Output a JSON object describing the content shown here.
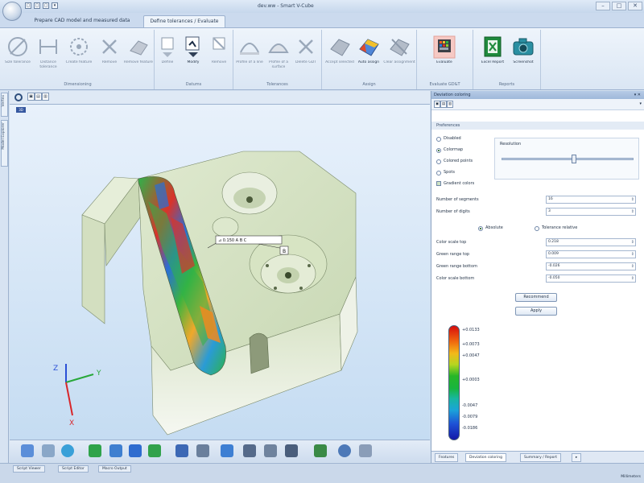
{
  "window": {
    "title": "dev.ww - Smart V-Cube",
    "controls": [
      "–",
      "□",
      "✕"
    ]
  },
  "quick_access": [
    "▢",
    "▢",
    "▢",
    "▾"
  ],
  "ribbon_tabs": {
    "prepare": "Prepare CAD model and measured data",
    "define": "Define tolerances / Evaluate"
  },
  "ribbon_groups": {
    "dimensioning": "Dimensioning",
    "datums": "Datums",
    "tolerances": "Tolerances",
    "assign": "Assign",
    "evaluate": "Evaluate GD&T",
    "reports": "Reports"
  },
  "ribbon_buttons": {
    "size_tolerance": "Size tolerance",
    "distance_tolerance": "Distance tolerance",
    "create_feature": "Create feature",
    "remove": "Remove",
    "remove_feature": "Remove feature",
    "define": "Define",
    "modify": "Modify",
    "remove_datum": "Remove",
    "profile_of_a_line": "Profile of a line",
    "profile_of_a_surface": "Profile of a surface",
    "delete_gdt": "Delete GDT",
    "accept_selected": "Accept selected",
    "auto_assign": "Auto assign",
    "clear_assignment": "Clear assignment",
    "evaluate": "Evaluate",
    "excel_report": "Excel Report",
    "screenshot": "Screenshot"
  },
  "left_tabs": [
    "Vertex",
    "Model Explorer"
  ],
  "viewport": {
    "logo": "3D",
    "axis_labels": {
      "z": "Z",
      "y": "Y",
      "x": "X"
    },
    "annotation_text": "⊿ 0.150 A B C",
    "datum_label": "B"
  },
  "panel": {
    "title": "Deviation coloring",
    "pin": "▾ ✕",
    "section": "Preferences",
    "color_modes": [
      {
        "label": "Disabled",
        "selected": false
      },
      {
        "label": "Colormap",
        "selected": true
      },
      {
        "label": "Colored points",
        "selected": false
      },
      {
        "label": "Spots",
        "selected": false
      }
    ],
    "gradient_checkbox": "Gradient colors",
    "resolution_label": "Resolution",
    "resolution_level": 0.55,
    "segments_label": "Number of segments",
    "segments_value": "16",
    "digits_label": "Number of digits",
    "digits_value": "3",
    "mode_absolute": "Absolute",
    "mode_relative": "Tolerance relative",
    "color_top_label": "Color scale top",
    "color_top_value": "0.218",
    "green_top_label": "Green range top",
    "green_top_value": "0.009",
    "green_bottom_label": "Green range bottom",
    "green_bottom_value": "-0.026",
    "color_bottom_label": "Color scale bottom",
    "color_bottom_value": "-0.050",
    "recommend_btn": "Recommend",
    "apply_btn": "Apply",
    "scale_labels": [
      "+0.0133",
      "+0.0073",
      "+0.0047",
      "+0.0003",
      "-0.0047",
      "-0.0079",
      "-0.0186"
    ],
    "bottom_tabs": [
      "Features",
      "Deviation coloring",
      "Summary / Report",
      "▸"
    ]
  },
  "status_tabs": [
    "Script Viewer",
    "Script Editor",
    "Macro Output"
  ],
  "status_units": "Millimeters"
}
